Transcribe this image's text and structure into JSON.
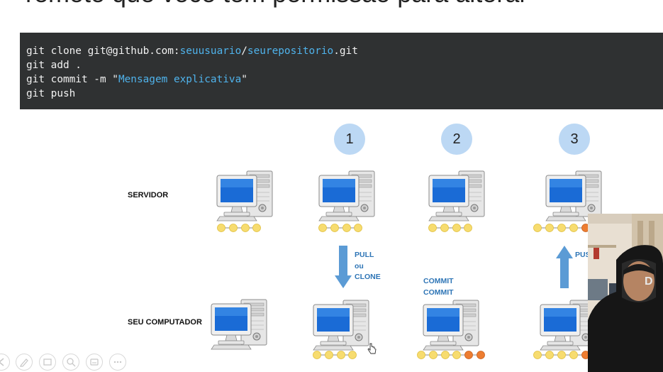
{
  "slide": {
    "heading": "remoto que você tem permissão para alterar"
  },
  "code_block": {
    "line1_prefix": "git clone git@github.com:",
    "line1_user": "seuusuario",
    "line1_sep": "/",
    "line1_repo": "seurepositorio",
    "line1_suffix": ".git",
    "line2": "git add .",
    "line3_prefix": "git commit -m \"",
    "line3_msg": "Mensagem explicativa",
    "line3_suffix": "\"",
    "line4": "git push"
  },
  "diagram": {
    "steps": [
      "1",
      "2",
      "3"
    ],
    "row_server_label": "SERVIDOR",
    "row_local_label": "SEU COMPUTADOR",
    "pull_label": [
      "PULL",
      "ou",
      "CLONE"
    ],
    "commit_label": [
      "COMMIT",
      "COMMIT"
    ],
    "push_label": "PUSH",
    "colors": {
      "commit_yellow": "#f7dc6f",
      "commit_orange": "#ed7d31",
      "arrow_blue": "#5b9bd5",
      "label_blue": "#2e75b6",
      "badge_bg": "#bcd8f4"
    }
  },
  "toolbar": {
    "icons": [
      "arrow-left-icon",
      "pen-icon",
      "slides-icon",
      "zoom-icon",
      "subtitles-icon",
      "more-icon"
    ]
  }
}
